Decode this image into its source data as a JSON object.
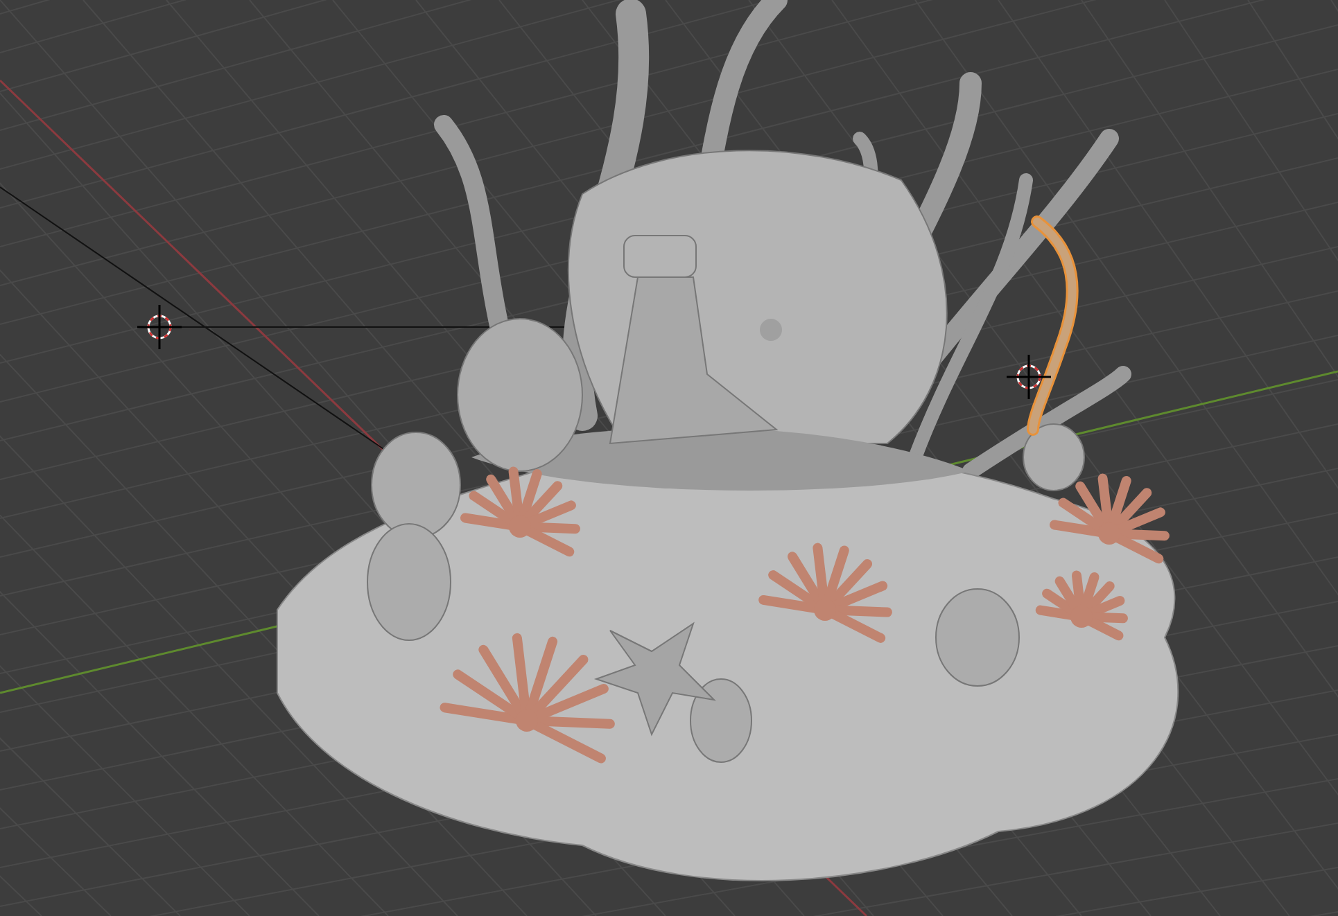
{
  "viewport": {
    "kind": "perspective",
    "objects": [
      {
        "kind": "sculpture",
        "selected": false
      },
      {
        "kind": "seaweed",
        "selected": true
      }
    ]
  }
}
